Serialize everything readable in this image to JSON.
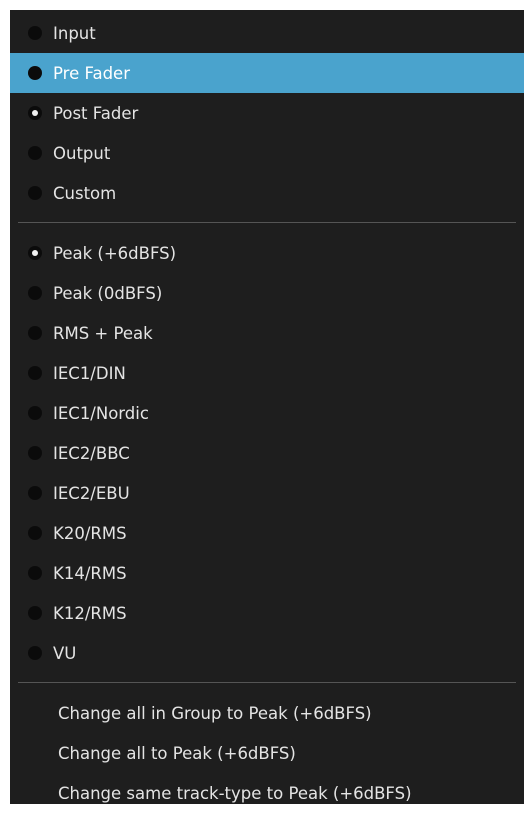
{
  "colors": {
    "menu_background": "#1e1e1e",
    "highlight": "#4aa3cd",
    "text": "#e4e4e4",
    "separator": "#555555"
  },
  "menu": {
    "position_group": [
      {
        "label": "Input",
        "selected": false,
        "highlighted": false
      },
      {
        "label": "Pre Fader",
        "selected": false,
        "highlighted": true
      },
      {
        "label": "Post Fader",
        "selected": true,
        "highlighted": false
      },
      {
        "label": "Output",
        "selected": false,
        "highlighted": false
      },
      {
        "label": "Custom",
        "selected": false,
        "highlighted": false
      }
    ],
    "meter_type_group": [
      {
        "label": "Peak (+6dBFS)",
        "selected": true
      },
      {
        "label": "Peak (0dBFS)",
        "selected": false
      },
      {
        "label": "RMS + Peak",
        "selected": false
      },
      {
        "label": "IEC1/DIN",
        "selected": false
      },
      {
        "label": "IEC1/Nordic",
        "selected": false
      },
      {
        "label": "IEC2/BBC",
        "selected": false
      },
      {
        "label": "IEC2/EBU",
        "selected": false
      },
      {
        "label": "K20/RMS",
        "selected": false
      },
      {
        "label": "K14/RMS",
        "selected": false
      },
      {
        "label": "K12/RMS",
        "selected": false
      },
      {
        "label": "VU",
        "selected": false
      }
    ],
    "actions": [
      {
        "label": "Change all in Group to Peak (+6dBFS)"
      },
      {
        "label": "Change all to Peak (+6dBFS)"
      },
      {
        "label": "Change same track-type to Peak (+6dBFS)"
      }
    ]
  }
}
